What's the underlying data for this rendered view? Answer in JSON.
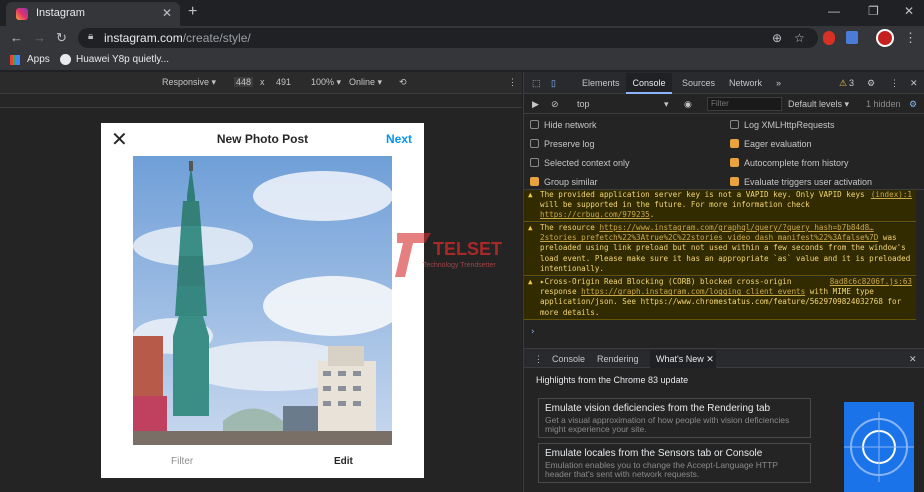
{
  "browser": {
    "tab_title": "Instagram",
    "tab_close": "✕",
    "new_tab": "+",
    "url_host": "instagram.com",
    "url_path": "/create/style/",
    "bookmarks": [
      "Apps",
      "Huawei Y8p quietly..."
    ],
    "icons": [
      "back-icon",
      "forward-icon",
      "reload-icon",
      "lock-icon",
      "add-icon",
      "star-icon",
      "extension-icon",
      "profile-icon",
      "menu-icon"
    ]
  },
  "device_toolbar": {
    "mode": "Responsive",
    "width": "448",
    "times": "x",
    "height": "491",
    "zoom": "100%",
    "network": "Online"
  },
  "page": {
    "title": "New Photo Post",
    "next_label": "Next",
    "close_glyph": "✕",
    "tab_filter": "Filter",
    "tab_edit": "Edit",
    "accent": "#0095f6"
  },
  "devtools": {
    "tabs": [
      "Elements",
      "Console",
      "Sources",
      "Network"
    ],
    "more_tabs": "»",
    "warning_count": "3",
    "context": "top",
    "filter_placeholder": "Filter",
    "levels": "Default levels",
    "hidden": "1 hidden",
    "settings": {
      "left": [
        {
          "label": "Hide network",
          "checked": false
        },
        {
          "label": "Preserve log",
          "checked": false
        },
        {
          "label": "Selected context only",
          "checked": false
        },
        {
          "label": "Group similar",
          "checked": true
        }
      ],
      "right": [
        {
          "label": "Log XMLHttpRequests",
          "checked": false
        },
        {
          "label": "Eager evaluation",
          "checked": true
        },
        {
          "label": "Autocomplete from history",
          "checked": true
        },
        {
          "label": "Evaluate triggers user activation",
          "checked": true
        }
      ]
    },
    "messages": [
      {
        "source": "(index):1",
        "text_pre": "The provided application server key is not a VAPID key. Only VAPID keys will be supported in the future. For more information check ",
        "link": "https://crbug.com/979235",
        "text_post": "."
      },
      {
        "source": "",
        "text_pre": "The resource ",
        "link": "https://www.instagram.com/graphql/query/?query_hash=b7b84d8…2stories_prefetch%22%3Atrue%2C%22stories_video_dash_manifest%22%3Afalse%7D",
        "text_post": " was preloaded using link preload but not used within a few seconds from the window's load event. Please make sure it has an appropriate `as` value and it is preloaded intentionally."
      },
      {
        "source": "8ad8c6c8206f.js:63",
        "text_pre": "▸Cross-Origin Read Blocking (CORB) blocked cross-origin response ",
        "link": "https://graph.instagram.com/logging_client_events",
        "text_post": " with MIME type application/json. See https://www.chromestatus.com/feature/5629709824032768 for more details."
      }
    ],
    "prompt": "›",
    "drawer_tabs": [
      "Console",
      "Rendering",
      "What's New"
    ],
    "drawer_close": "✕",
    "highlights_title": "Highlights from the Chrome 83 update",
    "cards": [
      {
        "title": "Emulate vision deficiencies from the Rendering tab",
        "desc": "Get a visual approximation of how people with vision deficiencies might experience your site."
      },
      {
        "title": "Emulate locales from the Sensors tab or Console",
        "desc": "Emulation enables you to change the Accept-Language HTTP header that's sent with network requests."
      }
    ]
  },
  "watermark": {
    "brand": "TELSET",
    "tagline": "Technology Trendsetter"
  }
}
